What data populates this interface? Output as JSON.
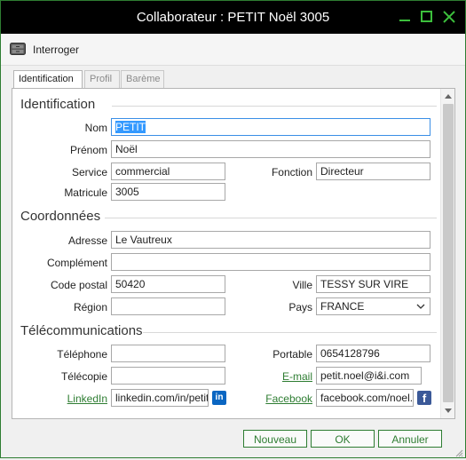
{
  "window": {
    "title": "Collaborateur : PETIT Noël 3005",
    "accent": "#2e7d32"
  },
  "toolbar": {
    "interroger_label": "Interroger"
  },
  "tabs": [
    {
      "label": "Identification"
    },
    {
      "label": "Profil"
    },
    {
      "label": "Barème"
    }
  ],
  "sections": {
    "identification": "Identification",
    "coordonnees": "Coordonnées",
    "telecom": "Télécommunications"
  },
  "fields": {
    "nom": {
      "label": "Nom",
      "value": "PETIT"
    },
    "prenom": {
      "label": "Prénom",
      "value": "Noël"
    },
    "service": {
      "label": "Service",
      "value": "commercial"
    },
    "fonction": {
      "label": "Fonction",
      "value": "Directeur"
    },
    "matricule": {
      "label": "Matricule",
      "value": "3005"
    },
    "adresse": {
      "label": "Adresse",
      "value": "Le Vautreux"
    },
    "complement": {
      "label": "Complément",
      "value": ""
    },
    "code_postal": {
      "label": "Code postal",
      "value": "50420"
    },
    "ville": {
      "label": "Ville",
      "value": "TESSY SUR VIRE"
    },
    "region": {
      "label": "Région",
      "value": ""
    },
    "pays": {
      "label": "Pays",
      "value": "FRANCE"
    },
    "telephone": {
      "label": "Téléphone",
      "value": ""
    },
    "portable": {
      "label": "Portable",
      "value": "0654128796"
    },
    "telecopie": {
      "label": "Télécopie",
      "value": ""
    },
    "email": {
      "label": "E-mail",
      "value": "petit.noel@i&i.com"
    },
    "linkedin": {
      "label": "LinkedIn",
      "value": "linkedin.com/in/petit"
    },
    "facebook": {
      "label": "Facebook",
      "value": "facebook.com/noel.p"
    }
  },
  "icons": {
    "linkedin_glyph": "in",
    "facebook_glyph": "f",
    "linkedin_color": "#0a66c2",
    "facebook_color": "#3b5998"
  },
  "buttons": {
    "nouveau": "Nouveau",
    "ok": "OK",
    "annuler": "Annuler"
  }
}
